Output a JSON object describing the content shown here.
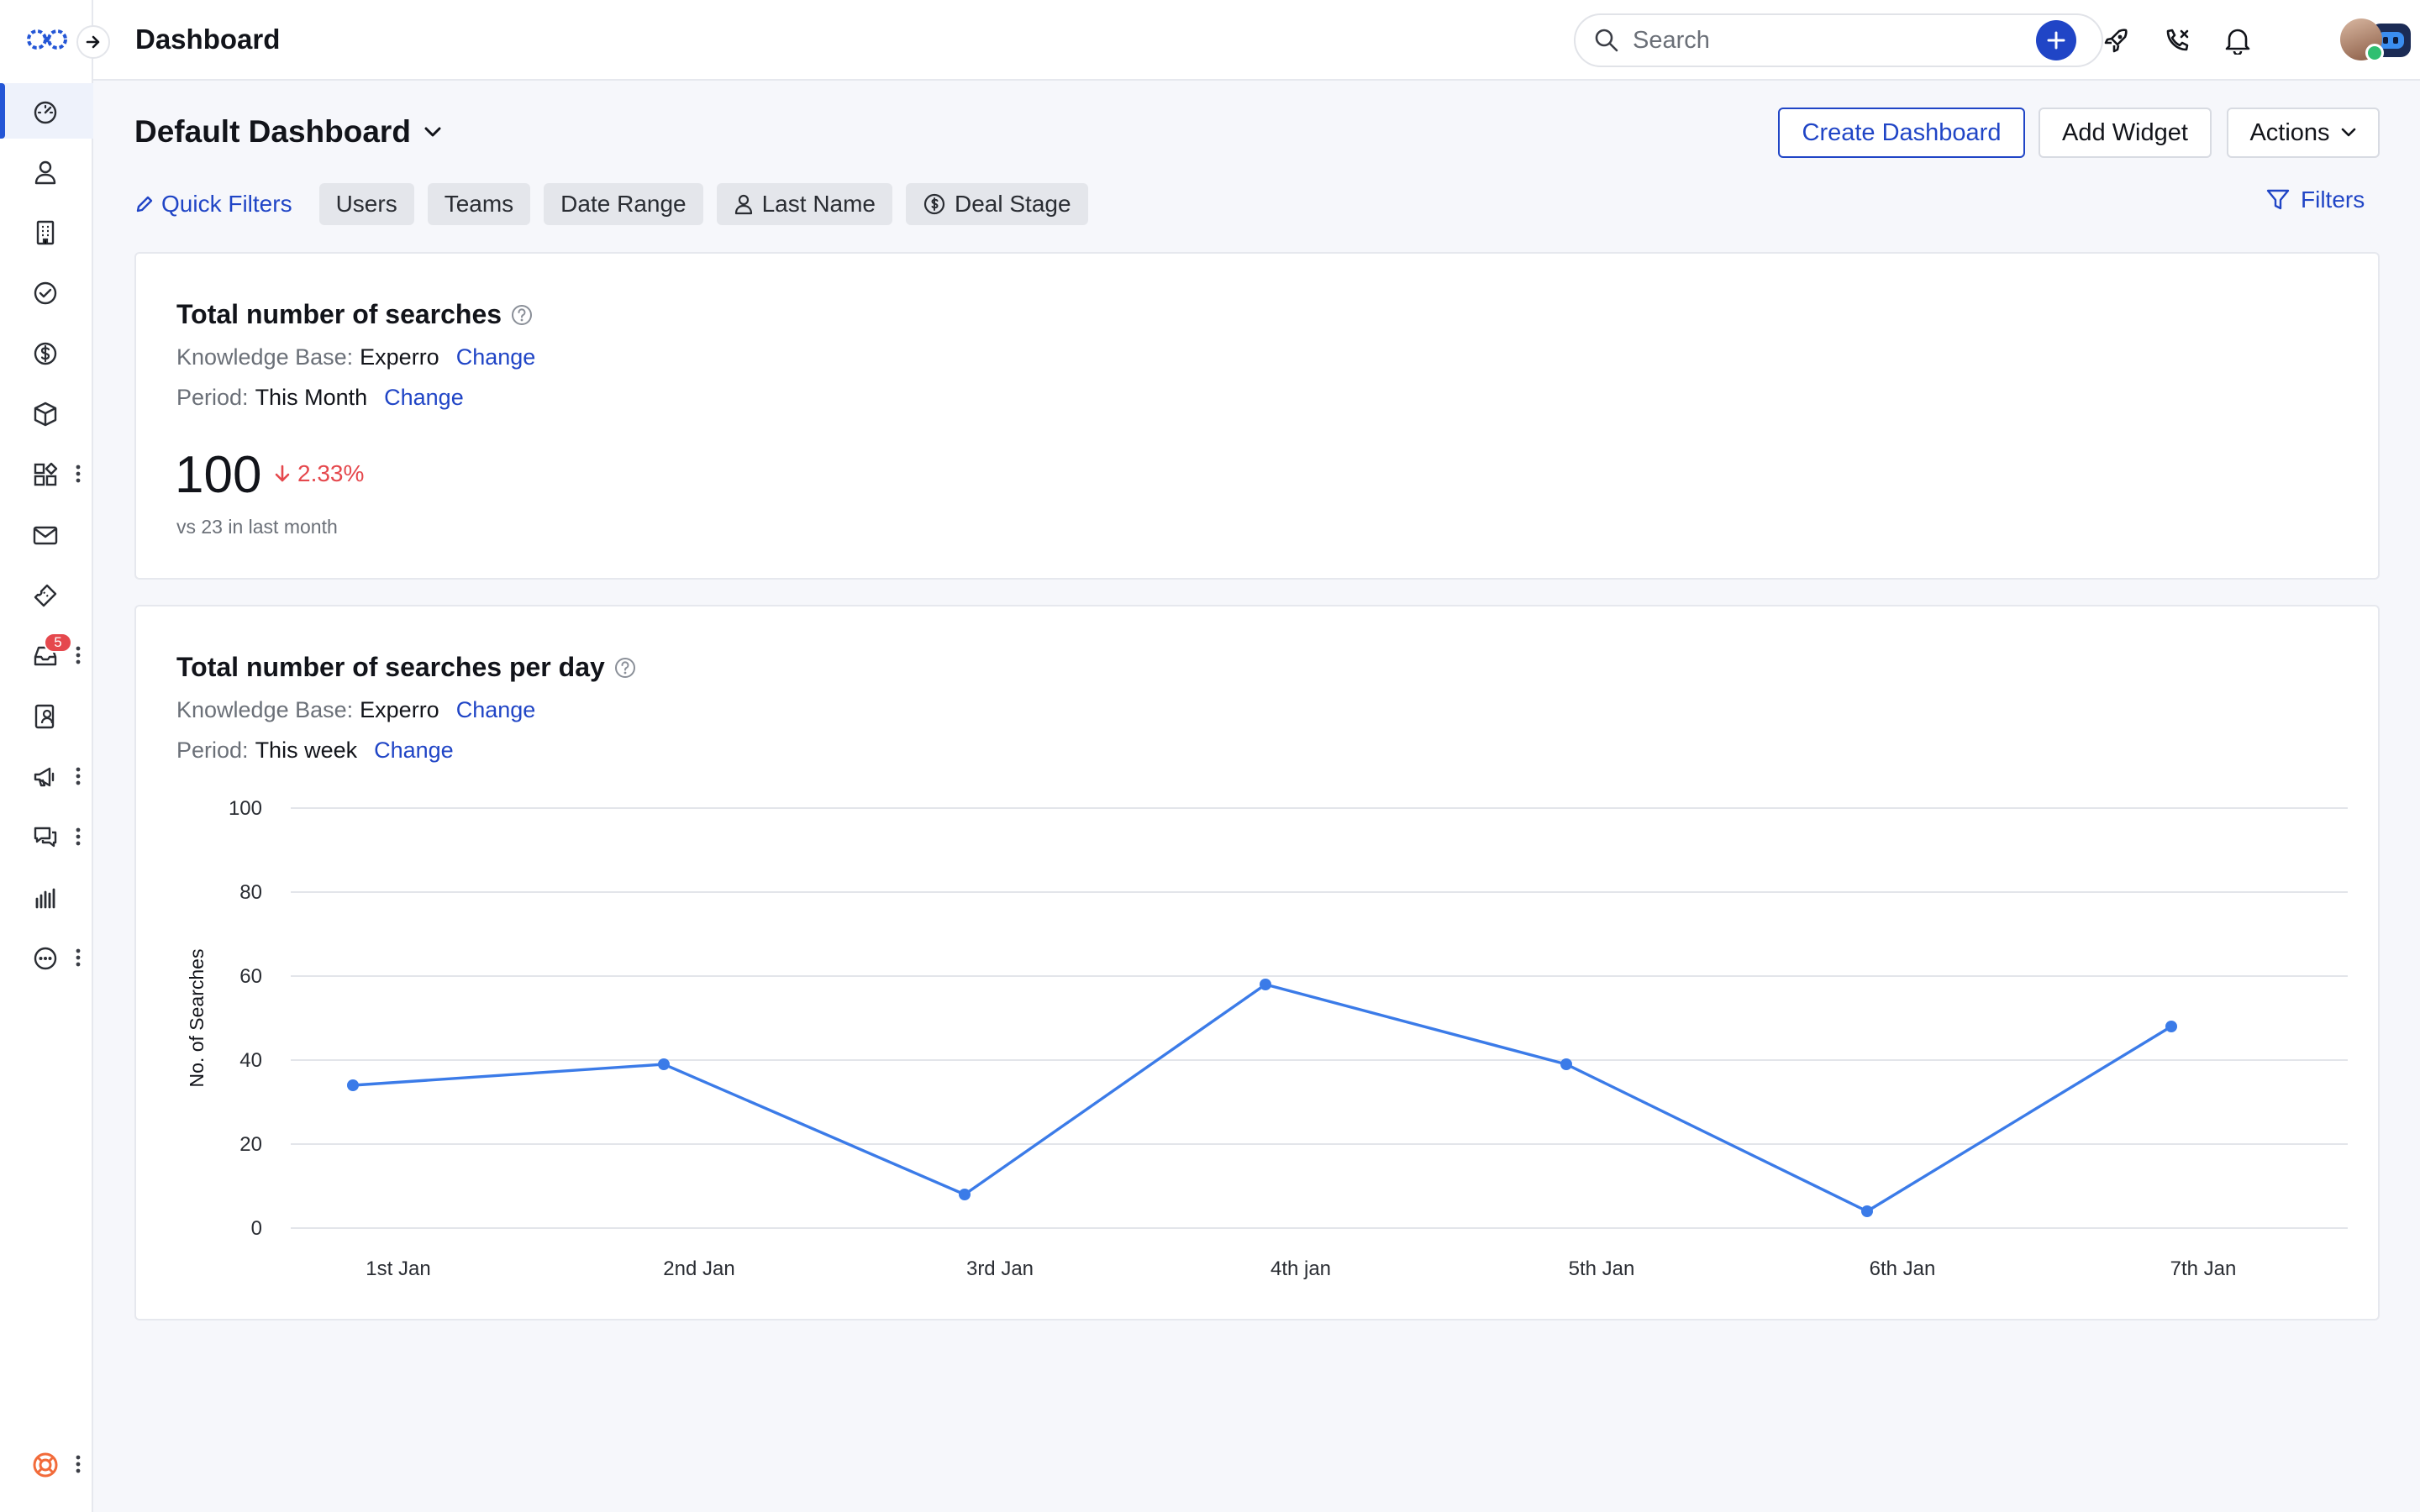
{
  "header": {
    "title": "Dashboard",
    "search_placeholder": "Search"
  },
  "sidebar": {
    "items": [
      {
        "icon": "speedometer-icon",
        "active": true
      },
      {
        "icon": "person-icon"
      },
      {
        "icon": "building-icon"
      },
      {
        "icon": "check-circle-icon"
      },
      {
        "icon": "dollar-icon"
      },
      {
        "icon": "box-icon"
      },
      {
        "icon": "apps-icon",
        "more": true
      },
      {
        "icon": "mail-icon"
      },
      {
        "icon": "ticket-icon"
      },
      {
        "icon": "inbox-icon",
        "more": true,
        "badge": "5"
      },
      {
        "icon": "contact-book-icon"
      },
      {
        "icon": "megaphone-icon",
        "more": true
      },
      {
        "icon": "chat-icon",
        "more": true
      },
      {
        "icon": "bars-icon"
      },
      {
        "icon": "more-circle-icon",
        "more": true
      }
    ],
    "bottom": {
      "icon": "lifebuoy-icon",
      "more": true
    }
  },
  "toolbar": {
    "dashboard_title": "Default Dashboard",
    "create_label": "Create Dashboard",
    "add_widget_label": "Add Widget",
    "actions_label": "Actions"
  },
  "quick_filters": {
    "label": "Quick Filters",
    "chips": [
      "Users",
      "Teams",
      "Date Range",
      "Last Name",
      "Deal Stage"
    ],
    "filters_label": "Filters"
  },
  "card1": {
    "title": "Total number of searches",
    "kb_label": "Knowledge Base:",
    "kb_value": "Experro",
    "change_label": "Change",
    "period_label": "Period:",
    "period_value": "This Month",
    "value": "100",
    "delta": "2.33%",
    "comparison": "vs 23 in last month"
  },
  "card2": {
    "title": "Total number of searches per day",
    "kb_label": "Knowledge Base:",
    "kb_value": "Experro",
    "change_label": "Change",
    "period_label": "Period:",
    "period_value": "This week"
  },
  "chart_data": {
    "type": "line",
    "categories": [
      "1st Jan",
      "2nd Jan",
      "3rd Jan",
      "4th jan",
      "5th Jan",
      "6th Jan",
      "7th Jan"
    ],
    "values": [
      34,
      39,
      8,
      58,
      39,
      4,
      48
    ],
    "ylabel": "No. of Searches",
    "ylim": [
      0,
      100
    ],
    "yticks": [
      0,
      20,
      40,
      60,
      80,
      100
    ],
    "grid": true,
    "color": "#3b7be8"
  },
  "colors": {
    "accent": "#2045c6",
    "negative": "#e5484d"
  }
}
